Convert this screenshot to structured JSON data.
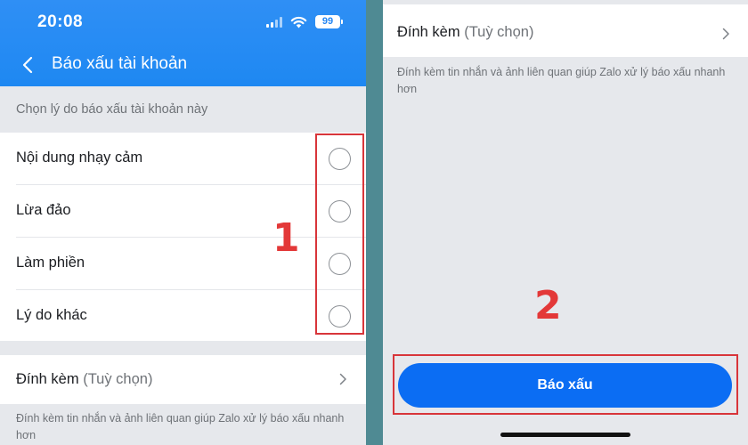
{
  "status_bar": {
    "time": "20:08",
    "battery": "99"
  },
  "nav": {
    "title": "Báo xấu tài khoản"
  },
  "reason_section": {
    "hint": "Chọn lý do báo xấu tài khoản này",
    "items": [
      {
        "label": "Nội dung nhạy cảm",
        "selected": false
      },
      {
        "label": "Lừa đảo",
        "selected": false
      },
      {
        "label": "Làm phiền",
        "selected": false
      },
      {
        "label": "Lý do khác",
        "selected": false
      }
    ]
  },
  "attachment": {
    "title": "Đính kèm",
    "optional": "(Tuỳ chọn)",
    "note": "Đính kèm tin nhắn và ảnh liên quan giúp Zalo xử lý báo xấu nhanh hơn"
  },
  "steps": {
    "step1": "1",
    "step2": "2"
  },
  "report_button": {
    "label": "Báo xấu"
  },
  "colors": {
    "header_blue": "#1e88f2",
    "button_blue": "#0b6df3",
    "highlight_red": "#d8353a"
  }
}
